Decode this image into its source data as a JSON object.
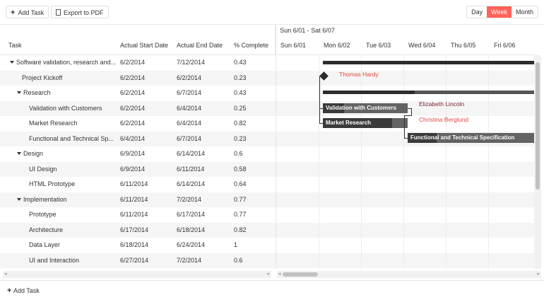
{
  "toolbar": {
    "add_task": "Add Task",
    "export_pdf": "Export to PDF",
    "views": [
      "Day",
      "Week",
      "Month"
    ],
    "selected_view": "Week",
    "accent": "#ff6358"
  },
  "grid": {
    "columns": [
      "Task",
      "Actual Start Date",
      "Actual End Date",
      "% Complete"
    ],
    "rows": [
      {
        "title": "Software validation, research and...",
        "start": "6/2/2014",
        "end": "7/12/2014",
        "complete": "0.43",
        "level": 0,
        "expanded": true
      },
      {
        "title": "Project Kickoff",
        "start": "6/2/2014",
        "end": "6/2/2014",
        "complete": "0.23",
        "level": 1
      },
      {
        "title": "Research",
        "start": "6/2/2014",
        "end": "6/7/2014",
        "complete": "0.43",
        "level": 1,
        "expanded": true
      },
      {
        "title": "Validation with Customers",
        "start": "6/2/2014",
        "end": "6/4/2014",
        "complete": "0.25",
        "level": 2
      },
      {
        "title": "Market Research",
        "start": "6/2/2014",
        "end": "6/4/2014",
        "complete": "0.82",
        "level": 2
      },
      {
        "title": "Functional and Technical Sp...",
        "start": "6/4/2014",
        "end": "6/7/2014",
        "complete": "0.23",
        "level": 2
      },
      {
        "title": "Design",
        "start": "6/9/2014",
        "end": "6/14/2014",
        "complete": "0.6",
        "level": 1,
        "expanded": true
      },
      {
        "title": "UI Design",
        "start": "6/9/2014",
        "end": "6/11/2014",
        "complete": "0.58",
        "level": 2
      },
      {
        "title": "HTML Prototype",
        "start": "6/11/2014",
        "end": "6/14/2014",
        "complete": "0.64",
        "level": 2
      },
      {
        "title": "Implementation",
        "start": "6/11/2014",
        "end": "7/2/2014",
        "complete": "0.77",
        "level": 1,
        "expanded": true
      },
      {
        "title": "Prototype",
        "start": "6/11/2014",
        "end": "6/17/2014",
        "complete": "0.77",
        "level": 2
      },
      {
        "title": "Architecture",
        "start": "6/17/2014",
        "end": "6/18/2014",
        "complete": "0.82",
        "level": 2
      },
      {
        "title": "Data Layer",
        "start": "6/18/2014",
        "end": "6/24/2014",
        "complete": "1",
        "level": 2
      },
      {
        "title": "UI and Interaction",
        "start": "6/27/2014",
        "end": "7/2/2014",
        "complete": "0.6",
        "level": 2
      }
    ]
  },
  "timeline": {
    "range": "Sun 6/01 - Sat 6/07",
    "days": [
      "Sun 6/01",
      "Mon 6/02",
      "Tue 6/03",
      "Wed 6/04",
      "Thu 6/05",
      "Fri 6/06"
    ],
    "bars": {
      "validation": "Validation with Customers",
      "market": "Market Research",
      "functional": "Functional and Technical Specification"
    },
    "resources": {
      "kickoff": {
        "name": "Thomas Hardy",
        "color": "#e0473f"
      },
      "validation": {
        "name": "Elizabeth Lincoln",
        "color": "#7a1e2c"
      },
      "market": {
        "name": "Christina Berglund",
        "color": "#e0473f"
      }
    }
  },
  "footer": {
    "add_task": "Add Task"
  }
}
